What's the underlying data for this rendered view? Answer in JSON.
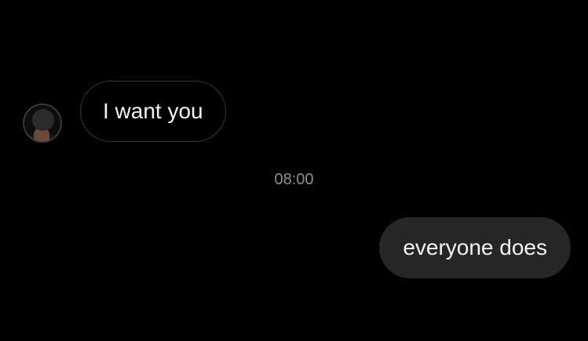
{
  "conversation": {
    "messages": [
      {
        "sender": "other",
        "text": "I want you"
      },
      {
        "sender": "me",
        "text": "everyone does"
      }
    ],
    "timestamp": "08:00"
  },
  "colors": {
    "background": "#000000",
    "incoming_bubble_border": "#3a3a3a",
    "outgoing_bubble": "#262626",
    "text": "#f2f2f2",
    "timestamp": "#8e8e93"
  },
  "icons": {
    "avatar": "profile-avatar-icon"
  }
}
